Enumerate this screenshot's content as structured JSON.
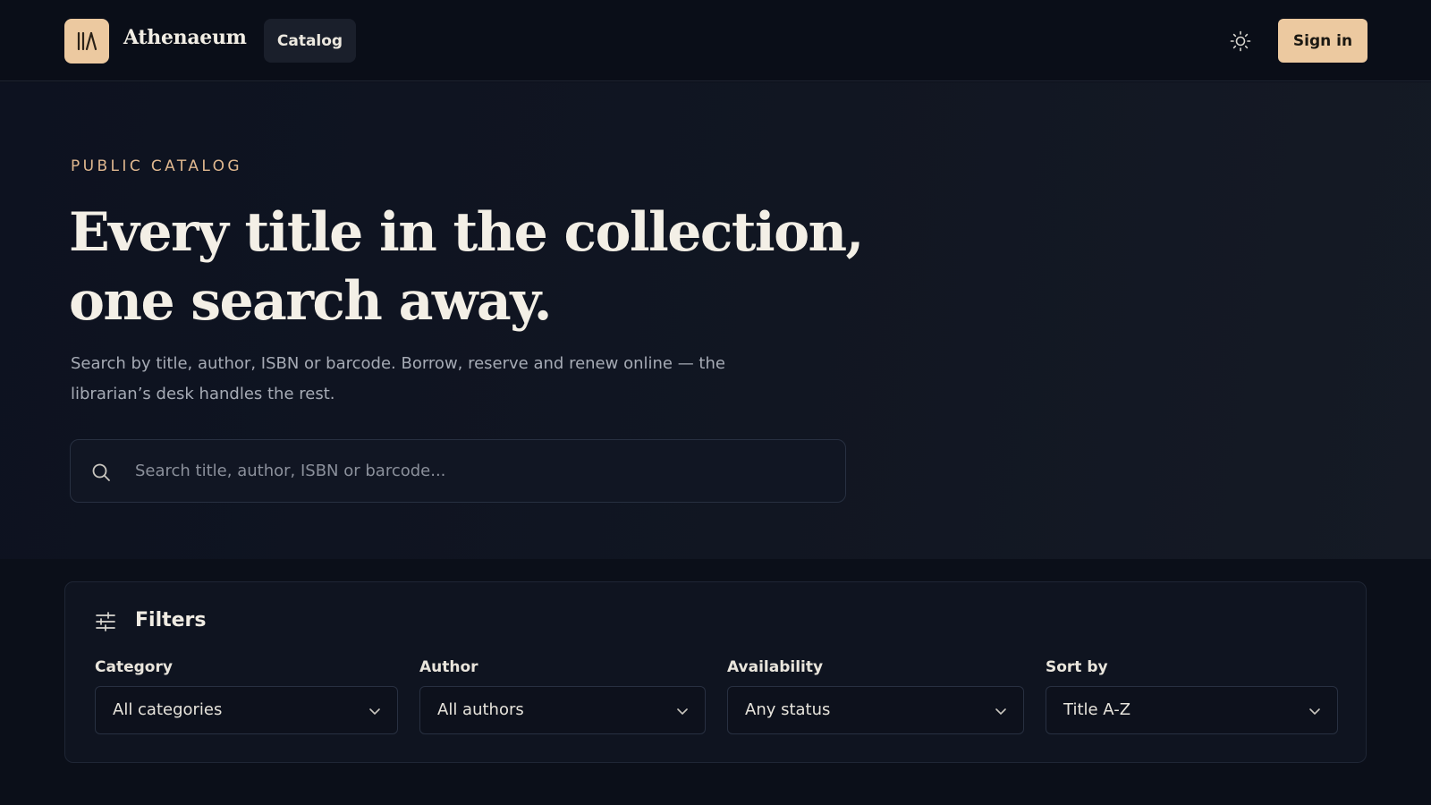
{
  "header": {
    "brand": "Athenaeum",
    "nav": {
      "catalog_label": "Catalog"
    },
    "signin_label": "Sign in"
  },
  "hero": {
    "eyebrow": "PUBLIC CATALOG",
    "headline_line1": "Every title in the collection,",
    "headline_line2": "one search away.",
    "subtext_line1": "Search by title, author, ISBN or barcode. Borrow, reserve and renew online — the",
    "subtext_line2": "librarian’s desk handles the rest.",
    "search_placeholder": "Search title, author, ISBN or barcode..."
  },
  "filters": {
    "title": "Filters",
    "fields": [
      {
        "label": "Category",
        "value": "All categories"
      },
      {
        "label": "Author",
        "value": "All authors"
      },
      {
        "label": "Availability",
        "value": "Any status"
      },
      {
        "label": "Sort by",
        "value": "Title A-Z"
      }
    ]
  },
  "colors": {
    "accent": "#ecc9a0",
    "background": "#0b0f19",
    "eyebrow": "#e0b88f"
  },
  "icons": {
    "logo": "library-books-icon",
    "theme": "sun-icon",
    "search": "search-icon",
    "filters": "sliders-icon",
    "select": "chevron-down-icon"
  }
}
